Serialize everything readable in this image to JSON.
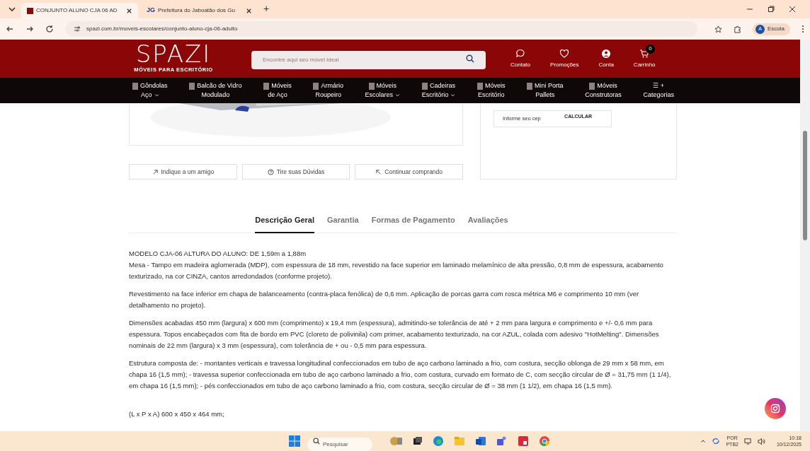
{
  "browser": {
    "tabs": [
      {
        "title": "CONJUNTO ALUNO CJA 06 AD",
        "selected": true
      },
      {
        "favicon": "JG",
        "title": "Prefeitura do Jaboatão dos Gu",
        "selected": false
      }
    ],
    "new_tab": "+",
    "url": "spazi.com.br/moveis-escolares/conjunto-aluno-cja-06-adulto",
    "profile": {
      "initial": "A",
      "name": "Escola"
    }
  },
  "header": {
    "logo": "SPAZI",
    "tagline": "MÓVEIS PARA ESCRITÓRIO",
    "search_placeholder": "Encontre aqui seu móvel ideal",
    "actions": [
      {
        "kind": "chat",
        "label": "Contato"
      },
      {
        "kind": "heart",
        "label": "Promoções"
      },
      {
        "kind": "user",
        "label": "Conta"
      },
      {
        "kind": "cart",
        "label": "Carrinho",
        "badge": "0"
      }
    ]
  },
  "nav": [
    {
      "lines": [
        "Gôndolas",
        "Aço"
      ],
      "dropdown": true
    },
    {
      "lines": [
        "Balcão de Vidro",
        "Modulado"
      ],
      "dropdown": false
    },
    {
      "lines": [
        "Móveis",
        "de Aço"
      ],
      "dropdown": false
    },
    {
      "lines": [
        "Armário",
        "Roupeiro"
      ],
      "dropdown": false
    },
    {
      "lines": [
        "Móveis",
        "Escolares"
      ],
      "dropdown": true
    },
    {
      "lines": [
        "Cadeiras",
        "Escritório"
      ],
      "dropdown": true
    },
    {
      "lines": [
        "Móveis",
        "Escritório"
      ],
      "dropdown": false
    },
    {
      "lines": [
        "Mini Porta",
        "Pallets"
      ],
      "dropdown": false
    },
    {
      "lines": [
        "Móveis",
        "Construtoras"
      ],
      "dropdown": false
    },
    {
      "lines": [
        "☰ +",
        "Categorias"
      ],
      "dropdown": false
    }
  ],
  "cep": {
    "placeholder": "Informe seu cep",
    "button": "CALCULAR"
  },
  "product_actions": [
    {
      "kind": "share",
      "label": "Indique a um amigo"
    },
    {
      "kind": "help",
      "label": "Tire suas Dúvidas"
    },
    {
      "kind": "back",
      "label": "Continuar comprando"
    }
  ],
  "tabs": [
    {
      "label": "Descrição Geral",
      "selected": true
    },
    {
      "label": "Garantia",
      "selected": false
    },
    {
      "label": "Formas de Pagamento",
      "selected": false
    },
    {
      "label": "Avaliações",
      "selected": false
    }
  ],
  "description": [
    [
      "MODELO CJA-06 ALTURA DO ALUNO: DE 1,59m a 1,88m",
      "Mesa - Tampo em madeira aglomerada (MDP), com espessura de 18 mm, revestido na face superior em laminado melamínico de alta pressão, 0,8 mm de espessura, acabamento texturizado, na cor CINZA, cantos arredondados (conforme projeto)."
    ],
    [
      "Revestimento na face inferior em chapa de balanceamento (contra-placa fenólica) de 0,6 mm. Aplicação de porcas garra com rosca métrica M6 e comprimento 10 mm (ver detalhamento no projeto)."
    ],
    [
      "Dimensões acabadas 450 mm (largura) x 600 mm (comprimento) x 19,4 mm (espessura), admitindo-se tolerância de até + 2 mm para largura e comprimento e +/- 0,6 mm para espessura. Topos encabeçados com fita de bordo em PVC (cloreto de polivinila) com primer, acabamento texturizado, na cor AZUL, colada com adesivo \"HotMelting\". Dimensões nominais de 22 mm (largura) x 3 mm (espessura), com tolerância de + ou - 0,5 mm para espessura."
    ],
    [
      "Estrutura composta de: - montantes verticais e travessa longitudinal confeccionados em tubo de aço carbono laminado a frio, com costura, secção oblonga de 29 mm x 58 mm, em chapa 16 (1,5 mm); - travessa superior confeccionada em tubo de aço carbono laminado a frio, com costura, curvado em formato de C, com secção circular de Ø = 31,75 mm (1 1/4), em chapa 16 (1,5 mm); - pés confeccionados em tubo de aço carbono laminado a frio, com costura, secção circular de Ø = 38 mm (1 1/2), em chapa 16 (1,5 mm)."
    ]
  ],
  "dimensions": "(L x P x A) 600 x 450 x 464 mm;",
  "taskbar": {
    "search_placeholder": "Pesquisar",
    "language": [
      "POR",
      "PTB2"
    ],
    "time": "10:18",
    "date": "10/12/2025"
  }
}
